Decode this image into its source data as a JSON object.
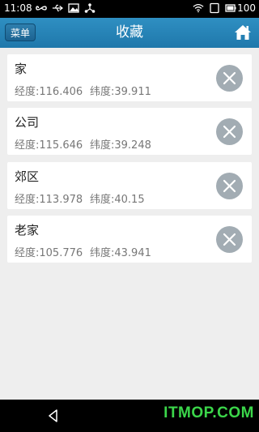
{
  "status_bar": {
    "time": "11:08",
    "battery_percent": "100",
    "left_icons": [
      "infinity-icon",
      "usb-icon",
      "image-icon",
      "share-icon"
    ],
    "right_icons": [
      "wifi-icon",
      "sim-icon",
      "battery-icon"
    ]
  },
  "header": {
    "menu_label": "菜单",
    "title": "收藏",
    "home_icon": "home-icon",
    "color": "#2a86b8"
  },
  "favorites": [
    {
      "name": "家",
      "lng_label": "经度:116.406",
      "lat_label": "纬度:39.911"
    },
    {
      "name": "公司",
      "lng_label": "经度:115.646",
      "lat_label": "纬度:39.248"
    },
    {
      "name": "郊区",
      "lng_label": "经度:113.978",
      "lat_label": "纬度:40.15"
    },
    {
      "name": "老家",
      "lng_label": "经度:105.776",
      "lat_label": "纬度:43.941"
    }
  ],
  "nav_bar": {
    "back_icon": "back-icon",
    "watermark": "ITMOP.COM"
  }
}
